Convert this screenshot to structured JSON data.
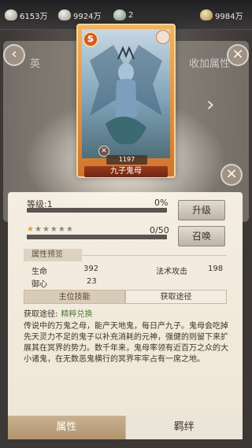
{
  "currencies": [
    {
      "icon": "silver-coin-icon",
      "value": "6153万"
    },
    {
      "icon": "silver-ingot-icon",
      "value": "9924万"
    },
    {
      "icon": "jade-token-icon",
      "value": "2"
    },
    {
      "icon": "gold-ingot-icon",
      "value": "9984万"
    }
  ],
  "card": {
    "grade": "S",
    "power": "1197",
    "name": "九子鬼母"
  },
  "level": {
    "label": "等级:1",
    "percent": "0%",
    "progress": 0
  },
  "stars": {
    "filled": 1,
    "total": 6,
    "count": "0/50"
  },
  "buttons": {
    "upgrade": "升级",
    "summon": "召唤"
  },
  "attributes": {
    "section_label": "属性预览",
    "hp_label": "生命",
    "hp_value": "392",
    "mag_label": "法术攻击",
    "mag_value": "198",
    "def_label": "御心",
    "def_value": "23"
  },
  "subtabs": {
    "skill": "主位技能",
    "source": "获取途径"
  },
  "source": {
    "label": "获取途径:",
    "value": "精粹兑换"
  },
  "description": "传说中的万鬼之母，能产天地鬼，每日产九子。鬼母会吃掉先天灵力不足的鬼子以补充消耗的元神，强健的则留下来扩展其在冥界的势力。数千年来，鬼母率领有近百万之众的大小诸鬼，在无数恶鬼横行的冥界牢牢占有一席之地。",
  "bottom_tabs": {
    "attributes": "属性",
    "bonds": "羁绊"
  },
  "background": {
    "tab_left": "英",
    "tab_right": "收加属性"
  }
}
